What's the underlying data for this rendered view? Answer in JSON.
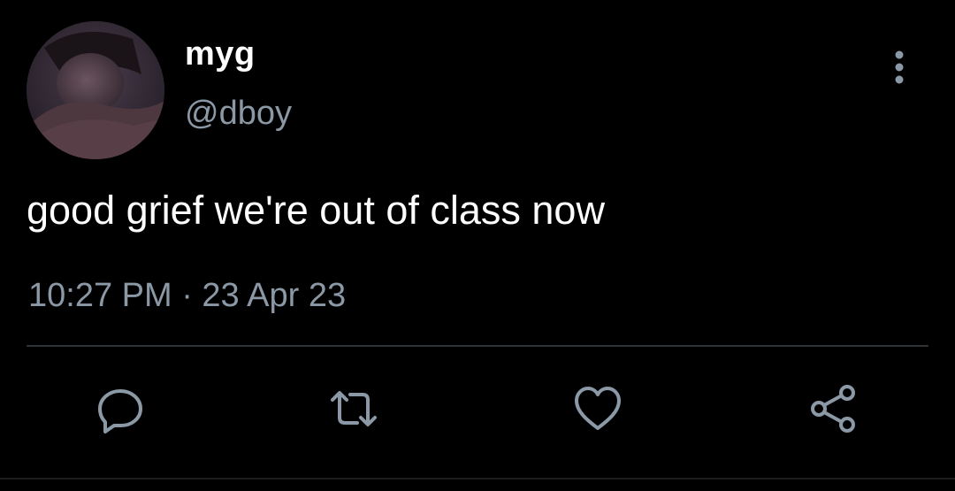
{
  "tweet": {
    "display_name": "myg",
    "handle": "@dboy",
    "text": "good grief we're out of class now",
    "timestamp": "10:27 PM · 23 Apr 23"
  },
  "icons": {
    "avatar": "profile-photo",
    "more": "vertical-dots-icon",
    "reply": "reply-icon",
    "retweet": "retweet-icon",
    "like": "heart-icon",
    "share": "share-icon"
  },
  "colors": {
    "background": "#000000",
    "primary_text": "#ffffff",
    "secondary_text": "#8b98a5",
    "divider": "#2f3336"
  }
}
